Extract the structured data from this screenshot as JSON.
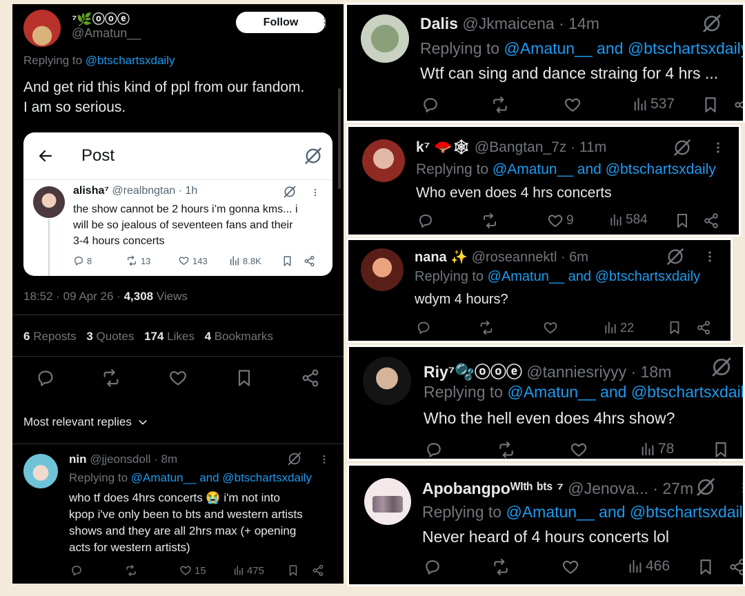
{
  "main_post": {
    "display_name": "⁷🌿ⓞⓞⓔ",
    "handle": "@Amatun__",
    "follow_label": "Follow",
    "replying_prefix": "Replying to",
    "replying_to": "@btschartsxdaily",
    "text_line1": "And get rid this kind of ppl from our fandom.",
    "text_line2": "I am so serious.",
    "embed": {
      "header_title": "Post",
      "name": "alisha⁷",
      "handle": "@realbngtan",
      "time": "· 1h",
      "text_line1": "the show cannot be 2 hours i’m gonna kms... i",
      "text_line2": "will be so jealous of seventeen fans and their",
      "text_line3": "3-4 hours concerts",
      "replies": "8",
      "reposts": "13",
      "likes": "143",
      "views": "8.8K"
    },
    "timestamp": "18:52 · 09 Apr 26 ·",
    "views_count": "4,308",
    "views_label": "Views",
    "reposts_count": "6",
    "reposts_label": "Reposts",
    "quotes_count": "3",
    "quotes_label": "Quotes",
    "likes_count": "174",
    "likes_label": "Likes",
    "bookmarks_count": "4",
    "bookmarks_label": "Bookmarks",
    "most_relevant_label": "Most relevant replies"
  },
  "left_reply": {
    "name": "nin",
    "handle": "@jjeonsdoll",
    "time": "· 8m",
    "replying_prefix": "Replying to",
    "replying_to": "@Amatun__ and @btschartsxdaily",
    "text_line1": "who tf does 4hrs concerts 😭 i'm not into",
    "text_line2": "kpop i've only been to bts and western artists",
    "text_line3": "shows and they are all 2hrs max (+ opening",
    "text_line4": "acts for western artists)",
    "likes": "15",
    "views": "475"
  },
  "replies": [
    {
      "name": "Dalis",
      "handle": "@Jkmaicena",
      "time": "· 14m",
      "replying_prefix": "Replying to",
      "replying_to": "@Amatun__ and @btschartsxdaily",
      "text": "Wtf can sing and dance straing for 4 hrs ...",
      "likes": "",
      "views": "537"
    },
    {
      "name": "k⁷ 🪭🕸",
      "handle": "@Bangtan_7z",
      "time": "· 11m",
      "replying_prefix": "Replying to",
      "replying_to": "@Amatun__ and @btschartsxdaily",
      "text": "Who even does 4 hrs concerts",
      "likes": "9",
      "views": "584"
    },
    {
      "name": "nana ✨",
      "handle": "@roseannektl",
      "time": "· 6m",
      "replying_prefix": "Replying to",
      "replying_to": "@Amatun__ and @btschartsxdaily",
      "text": "wdym 4 hours?",
      "likes": "",
      "views": "22"
    },
    {
      "name": "Riy⁷🫧ⓞⓞⓔ",
      "handle": "@tanniesriyyy",
      "time": "· 18m",
      "replying_prefix": "Replying to",
      "replying_to": "@Amatun__ and @btschartsxdaily",
      "text": "Who the hell even does 4hrs show?",
      "likes": "",
      "views": "78"
    },
    {
      "name": "Apobangpoᵂᴵᵗʰ ᵇᵗˢ ⁷",
      "handle": "@Jenova...",
      "time": "· 27m",
      "replying_prefix": "Replying to",
      "replying_to": "@Amatun__ and @btschartsxdaily",
      "text": "Never heard of 4 hours concerts lol",
      "likes": "",
      "views": "466"
    }
  ],
  "colors": {
    "accent": "#1d9bf0",
    "muted": "#71767b",
    "background": "#000000",
    "page": "#f3ead9"
  }
}
